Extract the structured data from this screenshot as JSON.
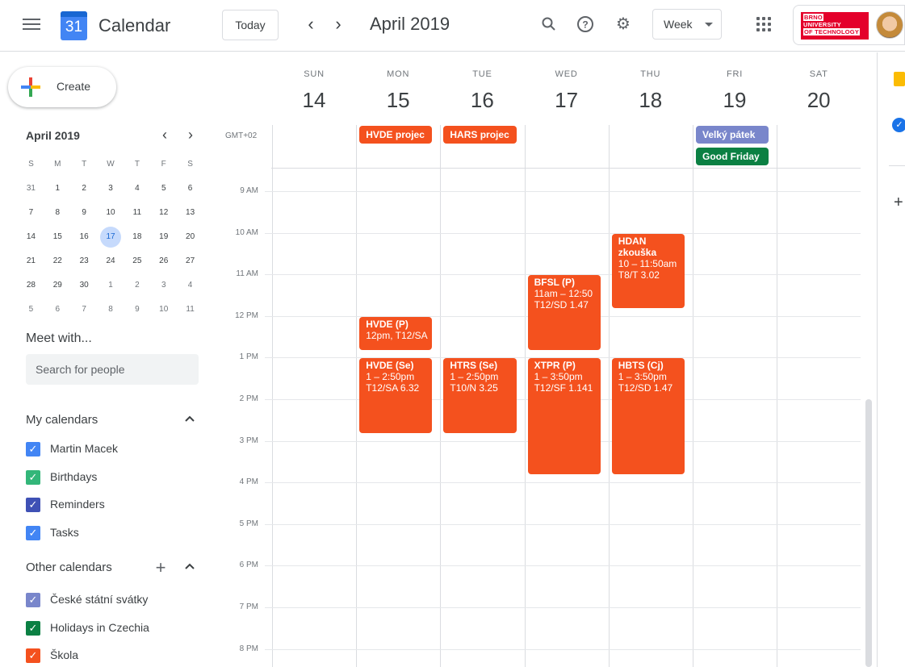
{
  "header": {
    "app_title": "Calendar",
    "logo_day": "31",
    "today_label": "Today",
    "prev_symbol": "‹",
    "next_symbol": "›",
    "period_title": "April 2019",
    "search_icon": "⌕",
    "help_icon": "?",
    "settings_icon": "⚙",
    "view_label": "Week",
    "org_lines": [
      "BRNO",
      "UNIVERSITY",
      "OF TECHNOLOGY"
    ]
  },
  "sidebar": {
    "create_label": "Create",
    "mini_cal": {
      "title": "April 2019",
      "prev": "‹",
      "next": "›",
      "weekdays": [
        "S",
        "M",
        "T",
        "W",
        "T",
        "F",
        "S"
      ],
      "weeks": [
        [
          "31",
          "1",
          "2",
          "3",
          "4",
          "5",
          "6"
        ],
        [
          "7",
          "8",
          "9",
          "10",
          "11",
          "12",
          "13"
        ],
        [
          "14",
          "15",
          "16",
          "17",
          "18",
          "19",
          "20"
        ],
        [
          "21",
          "22",
          "23",
          "24",
          "25",
          "26",
          "27"
        ],
        [
          "28",
          "29",
          "30",
          "1",
          "2",
          "3",
          "4"
        ],
        [
          "5",
          "6",
          "7",
          "8",
          "9",
          "10",
          "11"
        ]
      ],
      "today": "17"
    },
    "meet_title": "Meet with...",
    "search_placeholder": "Search for people",
    "my_calendars_title": "My calendars",
    "my_calendars": [
      {
        "label": "Martin Macek",
        "color": "#4285f4"
      },
      {
        "label": "Birthdays",
        "color": "#33b679"
      },
      {
        "label": "Reminders",
        "color": "#3f51b5"
      },
      {
        "label": "Tasks",
        "color": "#4285f4"
      }
    ],
    "other_calendars_title": "Other calendars",
    "other_calendars": [
      {
        "label": "České státní svátky",
        "color": "#7986cb"
      },
      {
        "label": "Holidays in Czechia",
        "color": "#0b8043"
      },
      {
        "label": "Škola",
        "color": "#f4511e"
      }
    ]
  },
  "week": {
    "days": [
      {
        "name": "SUN",
        "num": "14"
      },
      {
        "name": "MON",
        "num": "15"
      },
      {
        "name": "TUE",
        "num": "16"
      },
      {
        "name": "WED",
        "num": "17"
      },
      {
        "name": "THU",
        "num": "18"
      },
      {
        "name": "FRI",
        "num": "19"
      },
      {
        "name": "SAT",
        "num": "20"
      }
    ],
    "timezone": "GMT+02",
    "hours": [
      "9 AM",
      "10 AM",
      "11 AM",
      "12 PM",
      "1 PM",
      "2 PM",
      "3 PM",
      "4 PM",
      "5 PM",
      "6 PM",
      "7 PM",
      "8 PM"
    ],
    "all_day_events": [
      {
        "day": 1,
        "row": 0,
        "title": "HVDE projec",
        "color": "#f4511e"
      },
      {
        "day": 2,
        "row": 0,
        "title": "HARS projec",
        "color": "#f4511e"
      },
      {
        "day": 5,
        "row": 0,
        "title": "Velký pátek",
        "color": "#7986cb"
      },
      {
        "day": 5,
        "row": 1,
        "title": "Good Friday",
        "color": "#0b8043"
      }
    ],
    "events": [
      {
        "day": 1,
        "start": 12,
        "end": 12.83,
        "title": "HVDE (P)",
        "lines": [
          "12pm, T12/SA"
        ]
      },
      {
        "day": 1,
        "start": 13,
        "end": 14.83,
        "title": "HVDE (Se)",
        "lines": [
          "1 – 2:50pm",
          "T12/SA 6.32"
        ]
      },
      {
        "day": 2,
        "start": 13,
        "end": 14.83,
        "title": "HTRS (Se)",
        "lines": [
          "1 – 2:50pm",
          "T10/N 3.25"
        ]
      },
      {
        "day": 3,
        "start": 11,
        "end": 12.83,
        "title": "BFSL (P)",
        "lines": [
          "11am – 12:50",
          "T12/SD 1.47"
        ]
      },
      {
        "day": 3,
        "start": 13,
        "end": 15.83,
        "title": "XTPR (P)",
        "lines": [
          "1 – 3:50pm",
          "T12/SF 1.141"
        ]
      },
      {
        "day": 4,
        "start": 10,
        "end": 11.83,
        "title": "HDAN",
        "lines": [
          "zkouška",
          "10 – 11:50am",
          "T8/T 3.02"
        ],
        "bold_lines": 1
      },
      {
        "day": 4,
        "start": 13,
        "end": 15.83,
        "title": "HBTS (Cj)",
        "lines": [
          "1 – 3:50pm",
          "T12/SD 1.47"
        ]
      }
    ]
  },
  "right_panel": {
    "add_symbol": "+"
  }
}
